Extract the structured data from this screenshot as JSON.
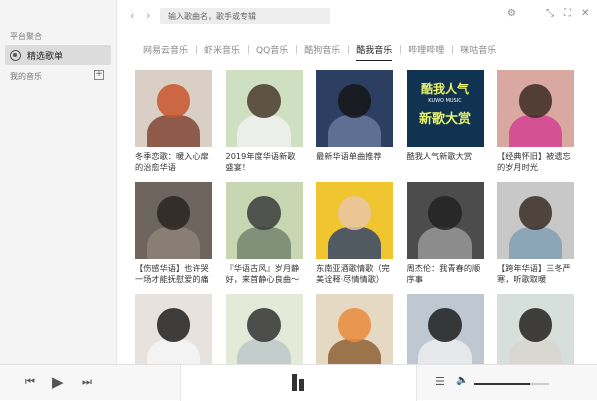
{
  "sidebar": {
    "section_platform": "平台聚合",
    "active_item": "精选歌单",
    "section_my_music": "我的音乐",
    "add_symbol": "+"
  },
  "topbar": {
    "back": "‹",
    "forward": "›",
    "search_placeholder": "输入歌曲名，歌手或专辑",
    "icons": [
      "gear-icon",
      "collapse-icon",
      "maximize-icon",
      "close-icon"
    ]
  },
  "tabs": [
    {
      "label": "网易云音乐",
      "active": false
    },
    {
      "label": "虾米音乐",
      "active": false
    },
    {
      "label": "QQ音乐",
      "active": false
    },
    {
      "label": "酷狗音乐",
      "active": false
    },
    {
      "label": "酷我音乐",
      "active": true
    },
    {
      "label": "哔哩哔哩",
      "active": false
    },
    {
      "label": "咪咕音乐",
      "active": false
    }
  ],
  "playlists": [
    {
      "title": "冬季恋歌：暖入心扉的治愈华语",
      "bg": "#d9cfc4",
      "head": "#c8552d",
      "body": "#7a3d2c"
    },
    {
      "title": "2019年度华语新歌盛宴！",
      "bg": "#cfe0c2",
      "head": "#4a3a2c",
      "body": "#f2f2f2"
    },
    {
      "title": "最新华语单曲推荐",
      "bg": "#2c3f63",
      "head": "#151515",
      "body": "#6b7ca0"
    },
    {
      "title": "酷我人气新歌大赏",
      "bg": "#0f3350",
      "head": "#0f3350",
      "body": "#0f3350",
      "overlay_top": "酷我人气",
      "overlay_mid": "KUWO MUSIC",
      "overlay_bottom": "新歌大赏"
    },
    {
      "title": "【经典怀旧】被遗忘的岁月时光",
      "bg": "#d9a9a1",
      "head": "#3a2b22",
      "body": "#d23b93"
    },
    {
      "title": "【伤感华语】也许哭一场才能抚慰爱的痛",
      "bg": "#6d655d",
      "head": "#2a2420",
      "body": "#8f857b"
    },
    {
      "title": "『华语古风』岁月静好，来首静心良曲～",
      "bg": "#c9d6b2",
      "head": "#3b3b3b",
      "body": "#6f7f6a"
    },
    {
      "title": "东南亚酒歌情歌（完美诠释·尽情情歌）",
      "bg": "#f0c530",
      "head": "#e9c6a7",
      "body": "#2b3f6e"
    },
    {
      "title": "周杰伦：我青春的顺序事",
      "bg": "#4c4c4c",
      "head": "#222222",
      "body": "#9c9c9c"
    },
    {
      "title": "【跨年华语】三冬严寒，听歌取暖",
      "bg": "#c8c8c8",
      "head": "#3a2c24",
      "body": "#7d9eb4"
    },
    {
      "title": "",
      "bg": "#e7e2de",
      "head": "#1e1e1e",
      "body": "#f7f7f7"
    },
    {
      "title": "",
      "bg": "#e4ead8",
      "head": "#333333",
      "body": "#b9c6c9"
    },
    {
      "title": "",
      "bg": "#e6d9c4",
      "head": "#e88a3c",
      "body": "#8a5a2e"
    },
    {
      "title": "",
      "bg": "#bfc7d1",
      "head": "#1c1c1c",
      "body": "#efefef"
    },
    {
      "title": "",
      "bg": "#d6dfdb",
      "head": "#24211e",
      "body": "#d8d5d0"
    }
  ],
  "player": {
    "prev": "⏮",
    "play": "▶",
    "next": "⏭",
    "playlist_icon": "☰",
    "volume_icon": "🔈",
    "volume_level": 0.75
  }
}
